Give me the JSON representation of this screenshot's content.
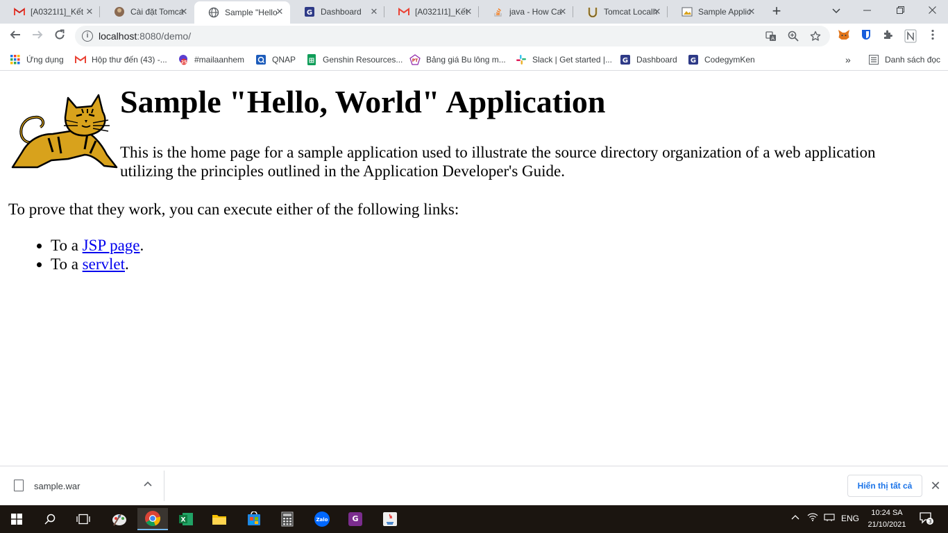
{
  "browser": {
    "tabs": [
      {
        "title": "[A0321I1]_Kết",
        "icon": "gmail-icon"
      },
      {
        "title": "Cài đặt Tomca",
        "icon": "avatar-icon"
      },
      {
        "title": "Sample \"Hello",
        "icon": "globe-icon",
        "active": true
      },
      {
        "title": "Dashboard",
        "icon": "codegym-icon"
      },
      {
        "title": "[A0321I1]_Kết",
        "icon": "gmail-icon"
      },
      {
        "title": "java - How Ca",
        "icon": "stackoverflow-icon"
      },
      {
        "title": "Tomcat Localh",
        "icon": "tomcat-icon"
      },
      {
        "title": "Sample Applic",
        "icon": "image-icon"
      }
    ],
    "new_tab_label": "+",
    "url_host": "localhost",
    "url_rest": ":8080/demo/",
    "bookmarks": [
      {
        "label": "Ứng dụng",
        "icon": "apps-grid-icon"
      },
      {
        "label": "Hộp thư đến (43) -...",
        "icon": "gmail-icon"
      },
      {
        "label": "#mailaanhem",
        "icon": "badge-25-icon"
      },
      {
        "label": "QNAP",
        "icon": "qnap-icon"
      },
      {
        "label": "Genshin Resources...",
        "icon": "sheets-icon"
      },
      {
        "label": "Bảng giá Bu lông m...",
        "icon": "pt-icon"
      },
      {
        "label": "Slack | Get started |...",
        "icon": "slack-icon"
      },
      {
        "label": "Dashboard",
        "icon": "codegym-icon"
      },
      {
        "label": "CodegymKen",
        "icon": "codegym-icon"
      }
    ],
    "bookmark_overflow": "»",
    "reading_list": "Danh sách đọc",
    "bookmark_badge": "25"
  },
  "page": {
    "heading": "Sample \"Hello, World\" Application",
    "intro": "This is the home page for a sample application used to illustrate the source directory organization of a web application utilizing the principles outlined in the Application Developer's Guide.",
    "prove": "To prove that they work, you can execute either of the following links:",
    "links": [
      {
        "prefix": "To a ",
        "link": "JSP page",
        "suffix": "."
      },
      {
        "prefix": "To a ",
        "link": "servlet",
        "suffix": "."
      }
    ]
  },
  "downloads": {
    "file": "sample.war",
    "show_all": "Hiển thị tất cả"
  },
  "taskbar": {
    "lang": "ENG",
    "time": "10:24 SA",
    "date": "21/10/2021",
    "notifications": "3"
  },
  "colors": {
    "tabstrip": "#dee1e6",
    "link": "#0000ee",
    "accent": "#1a73e8",
    "taskbar": "#1b1510",
    "tomcat_yellow": "#d8a21c"
  }
}
